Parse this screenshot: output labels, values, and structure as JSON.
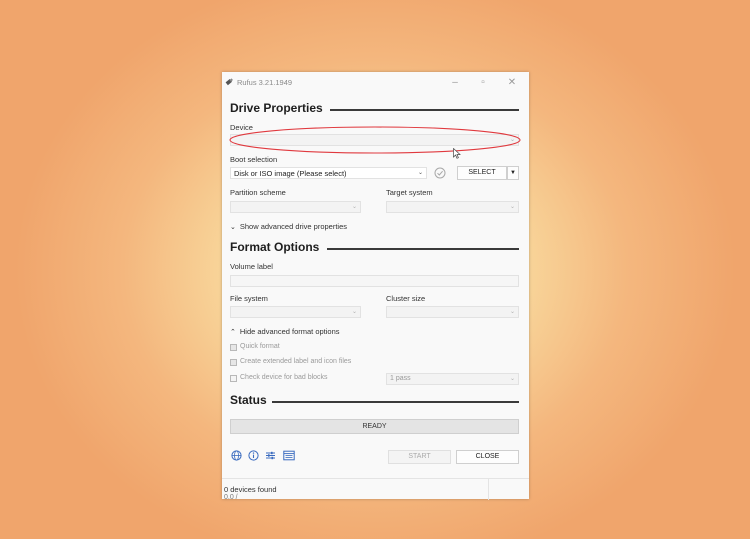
{
  "window": {
    "title": "Rufus 3.21.1949"
  },
  "drive_properties": {
    "heading": "Drive Properties",
    "device_label": "Device",
    "device_value": "",
    "boot_selection_label": "Boot selection",
    "boot_selection_value": "Disk or ISO image (Please select)",
    "select_button": "SELECT",
    "partition_scheme_label": "Partition scheme",
    "partition_scheme_value": "",
    "target_system_label": "Target system",
    "target_system_value": "",
    "advanced_toggle": "Show advanced drive properties"
  },
  "format_options": {
    "heading": "Format Options",
    "volume_label_label": "Volume label",
    "volume_label_value": "",
    "file_system_label": "File system",
    "file_system_value": "",
    "cluster_size_label": "Cluster size",
    "cluster_size_value": "",
    "advanced_toggle": "Hide advanced format options",
    "quick_format": "Quick format",
    "extended_label": "Create extended label and icon files",
    "bad_blocks": "Check device for bad blocks",
    "passes_value": "1 pass"
  },
  "status": {
    "heading": "Status",
    "progress_text": "READY",
    "progress_fraction": 0
  },
  "actions": {
    "start": "START",
    "close": "CLOSE"
  },
  "statusbar": {
    "devices_found": "0 devices found",
    "secondary": "0.0 /"
  },
  "icons": [
    "globe-icon",
    "info-icon",
    "settings-sliders-icon",
    "log-icon"
  ],
  "accent_colors": {
    "annotation_ellipse": "#e0393e",
    "icon_blue": "#3a6bbf"
  }
}
